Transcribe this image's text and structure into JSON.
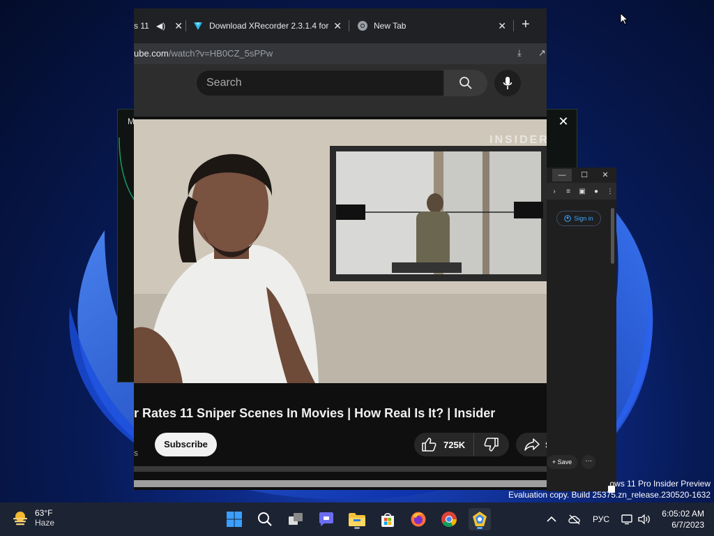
{
  "browser": {
    "tabs": [
      {
        "label": "s 11",
        "muted_icon": "speaker-icon"
      },
      {
        "label": "Download XRecorder 2.3.1.4 for",
        "icon": "xrecorder-icon"
      },
      {
        "label": "New Tab",
        "icon": "chrome-icon"
      }
    ],
    "new_tab_symbol": "+",
    "tab_close_symbol": "✕",
    "url_host": "ube.com",
    "url_path": "/watch?v=HB0CZ_5sPPw"
  },
  "youtube": {
    "search_placeholder": "Search",
    "video_title": "r Rates 11 Sniper Scenes In Movies | How Real Is It? | Insider",
    "subscribe_label": "Subscribe",
    "like_count": "725K",
    "share_label": "S",
    "watermark_logo": "INSIDER",
    "channel_fragment": "s"
  },
  "background_window": {
    "title_fragment": "M",
    "close_symbol": "✕"
  },
  "side_window": {
    "signin_label": "Sign in",
    "save_label": "Save",
    "more_symbol": "···"
  },
  "os_watermark": {
    "line1": "ows 11 Pro Insider Preview",
    "line2": "Evaluation copy. Build 25375.zn_release.230520-1632"
  },
  "taskbar": {
    "weather_temp": "63°F",
    "weather_condition": "Haze",
    "language": "РУС",
    "time": "6:05:02 AM",
    "date": "6/7/2023",
    "apps": [
      "windows-start-icon",
      "search-icon",
      "task-view-icon",
      "teams-chat-icon",
      "file-explorer-icon",
      "microsoft-store-icon",
      "firefox-icon",
      "chrome-icon",
      "xrecorder-icon"
    ]
  },
  "colors": {
    "accent_blue": "#3ea6ff",
    "yt_dark": "#0f0f0f",
    "taskbar": "#1c2333"
  }
}
